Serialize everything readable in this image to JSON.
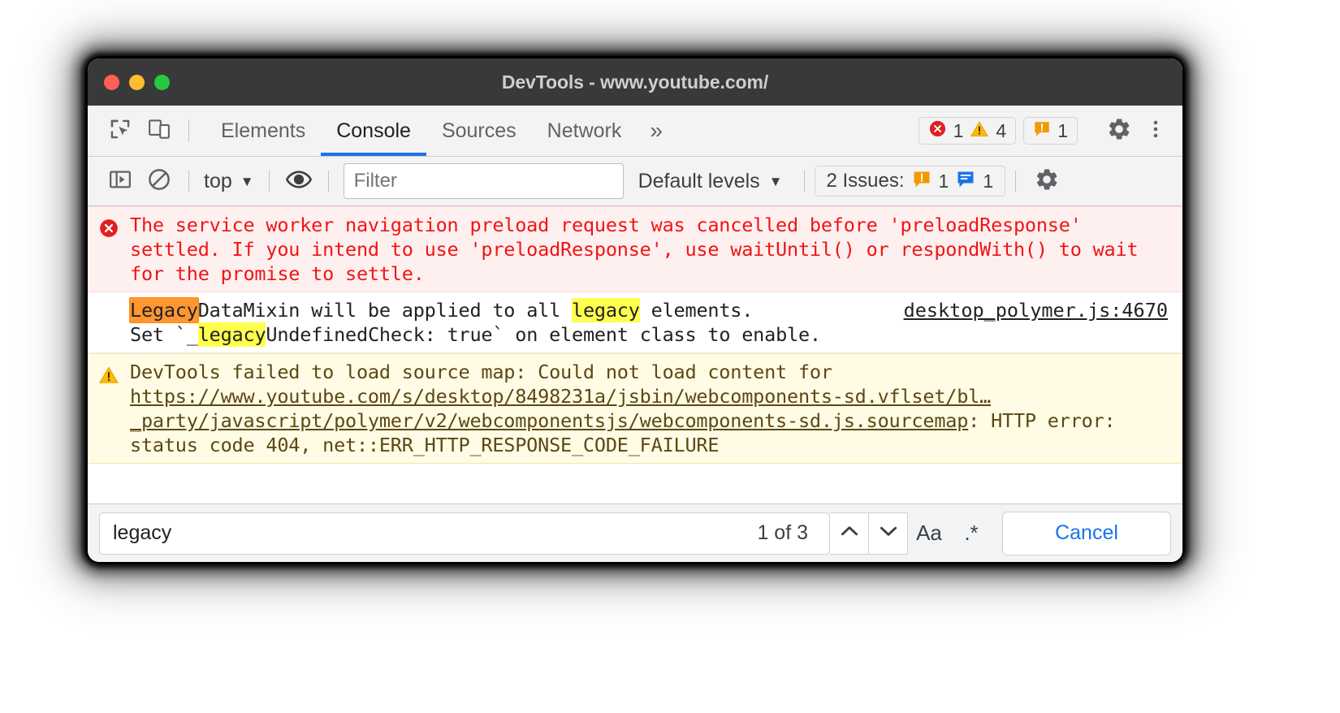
{
  "window": {
    "title": "DevTools - www.youtube.com/",
    "traffic_lights": [
      "close",
      "minimize",
      "zoom"
    ]
  },
  "tabbar": {
    "icons": [
      "inspect-element-icon",
      "device-toolbar-icon"
    ],
    "tabs": [
      {
        "label": "Elements",
        "active": false
      },
      {
        "label": "Console",
        "active": true
      },
      {
        "label": "Sources",
        "active": false
      },
      {
        "label": "Network",
        "active": false
      }
    ],
    "more_tabs": "»",
    "error_count": "1",
    "warning_count": "4",
    "issue_count": "1",
    "settings_icon": "gear-icon",
    "more_options_icon": "kebab-menu-icon"
  },
  "consolebar": {
    "sidebar_toggle_icon": "console-sidebar-icon",
    "clear_icon": "clear-console-icon",
    "context": "top",
    "context_caret": "▼",
    "eye_icon": "live-expression-icon",
    "filter_placeholder": "Filter",
    "filter_value": "",
    "levels_label": "Default levels",
    "levels_caret": "▼",
    "issues_label": "2 Issues:",
    "issues_warning_count": "1",
    "issues_info_count": "1",
    "settings_icon": "console-settings-gear-icon"
  },
  "console_messages": [
    {
      "kind": "error",
      "icon": "error-circle-icon",
      "segments": [
        {
          "t": "The service worker navigation preload request was cancelled before 'preloadResponse' settled. If you intend to use 'preloadResponse', use waitUntil() or respondWith() to wait for the promise to settle."
        }
      ],
      "source": null
    },
    {
      "kind": "plain",
      "icon": null,
      "segments": [
        {
          "t": "Legacy",
          "hl": "active"
        },
        {
          "t": "DataMixin will be applied to all "
        },
        {
          "t": "legacy",
          "hl": "match"
        },
        {
          "t": " elements.\nSet `_"
        },
        {
          "t": "legacy",
          "hl": "match"
        },
        {
          "t": "UndefinedCheck: true` on element class to enable."
        }
      ],
      "source": "desktop_polymer.js:4670"
    },
    {
      "kind": "warning",
      "icon": "warning-triangle-icon",
      "segments": [
        {
          "t": "DevTools failed to load source map: Could not load content for "
        },
        {
          "t": "https://www.youtube.com/s/desktop/8498231a/jsbin/webcomponents-sd.vflset/bl…_party/javascript/polymer/v2/webcomponentsjs/webcomponents-sd.js.sourcemap",
          "link": true
        },
        {
          "t": ": HTTP error: status code 404, net::ERR_HTTP_RESPONSE_CODE_FAILURE"
        }
      ],
      "source": null
    }
  ],
  "findbar": {
    "query": "legacy",
    "match_count": "1 of 3",
    "prev_icon": "chevron-up-icon",
    "next_icon": "chevron-down-icon",
    "match_case_label": "Aa",
    "regex_label": ".*",
    "cancel_label": "Cancel"
  },
  "colors": {
    "accent": "#1a73e8",
    "error": "#f01414",
    "error_bg": "#fff0f0",
    "warning_text": "#5c4813",
    "warning_bg": "#fffbe5",
    "highlight": "#ffff4d",
    "highlight_active": "#ff9632",
    "titlebar": "#393939"
  }
}
